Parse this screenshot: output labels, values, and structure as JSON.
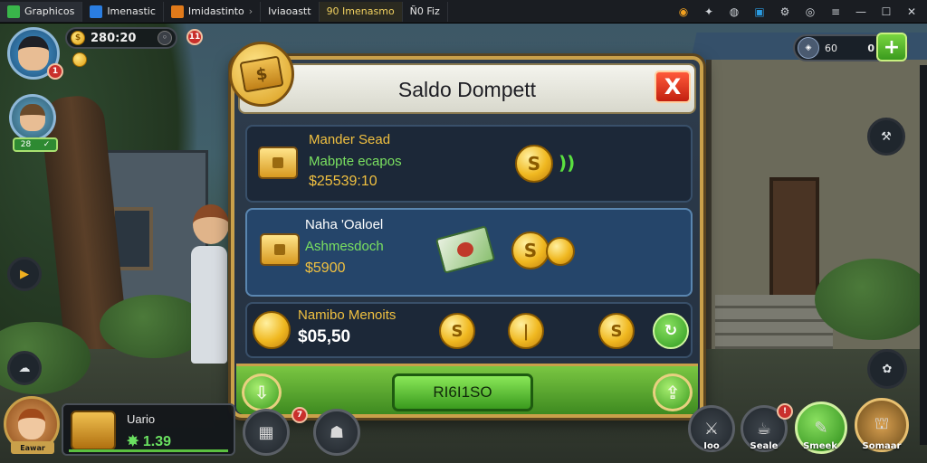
{
  "emulator": {
    "tabs": [
      {
        "label": "Graphicos",
        "color": "#39b54a"
      },
      {
        "label": "Imenastic",
        "color": "#2a7de1"
      },
      {
        "label": "Imidastinto",
        "color": "#e07a1a"
      },
      {
        "label": "Iviaoastt",
        "color": "#8a8f96"
      },
      {
        "label": "90 Imenasmo",
        "color": "#f0c020"
      },
      {
        "label": "Ñ0 Fiz",
        "color": "#555b63"
      }
    ],
    "controls": [
      "gem-icon",
      "gift-icon",
      "info-icon",
      "screen-icon",
      "settings-icon",
      "menu-icon",
      "minimize-icon",
      "maximize-icon",
      "close-icon"
    ]
  },
  "hud": {
    "currency_value": "280:20",
    "currency_badge": "11",
    "player_badge": "1",
    "player2_tag": "28",
    "resource_value": "0",
    "resource_badge": "60",
    "plus_label": "+"
  },
  "dialog": {
    "title": "Saldo Dompett",
    "close_label": "X",
    "rows": [
      {
        "title": "Mander Sead",
        "subtitle": "Mabpte ecapos",
        "amount": "$25539:10"
      },
      {
        "title": "Naha 'Oaloel",
        "subtitle": "Ashmesdoch",
        "amount": "$5900"
      },
      {
        "title": "Namibo Menoits",
        "amount": "$05,50"
      }
    ],
    "main_button": "RI6I1SO",
    "nav_left": "⇩",
    "nav_right": "⇪",
    "accent_color": "#c9a04a"
  },
  "bottom": {
    "hero_tag": "Eawar",
    "item_name": "Uario",
    "item_value": "✸ 1.39",
    "item_badge": "7",
    "buttons": [
      {
        "label": "Ioo"
      },
      {
        "label": "Seale"
      },
      {
        "label": "Smeek"
      },
      {
        "label": "Somaar"
      }
    ]
  }
}
